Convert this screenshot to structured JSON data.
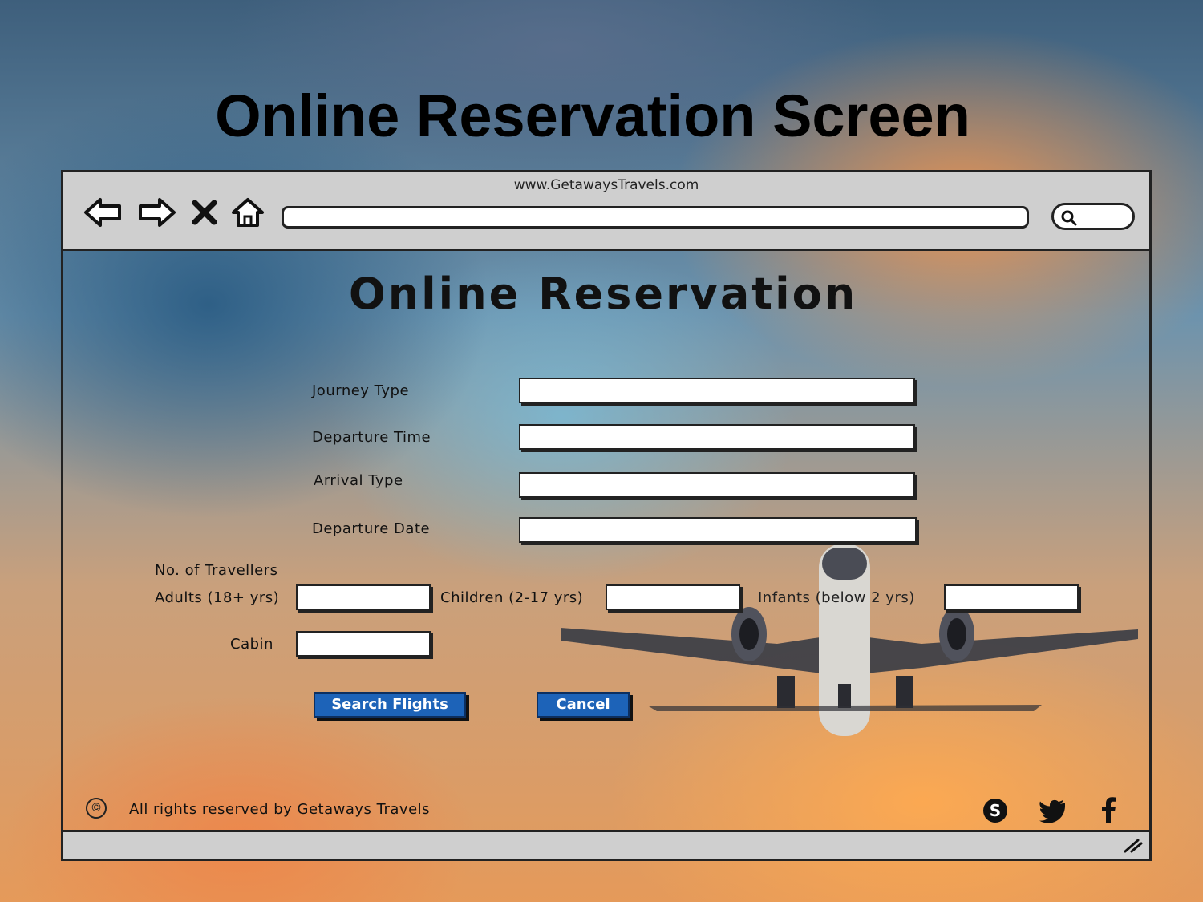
{
  "slide": {
    "title": "Online Reservation Screen"
  },
  "browser": {
    "url": "www.GetawaysTravels.com",
    "nav_icons": [
      "back-arrow-icon",
      "forward-arrow-icon",
      "close-icon",
      "home-icon"
    ],
    "search_icon": "search-icon"
  },
  "page": {
    "heading": "Online Reservation",
    "fields": {
      "journey_type": {
        "label": "Journey Type",
        "value": ""
      },
      "departure_time": {
        "label": "Departure Time",
        "value": ""
      },
      "arrival_type": {
        "label": "Arrival Type",
        "value": ""
      },
      "departure_date": {
        "label": "Departure Date",
        "value": ""
      }
    },
    "travellers": {
      "label": "No. of Travellers",
      "adults": {
        "label": "Adults (18+ yrs)",
        "value": ""
      },
      "children": {
        "label": "Children (2-17 yrs)",
        "value": ""
      },
      "infants": {
        "label": "Infants (below 2 yrs)",
        "value": ""
      }
    },
    "cabin": {
      "label": "Cabin",
      "value": ""
    },
    "buttons": {
      "search": "Search Flights",
      "cancel": "Cancel"
    },
    "footer": {
      "copyright_symbol": "©",
      "text": "All rights reserved by Getaways Travels",
      "social_icons": [
        "skype-icon",
        "twitter-icon",
        "facebook-icon"
      ]
    }
  },
  "colors": {
    "button": "#1d63b8",
    "toolbar": "#cfcfcf"
  }
}
